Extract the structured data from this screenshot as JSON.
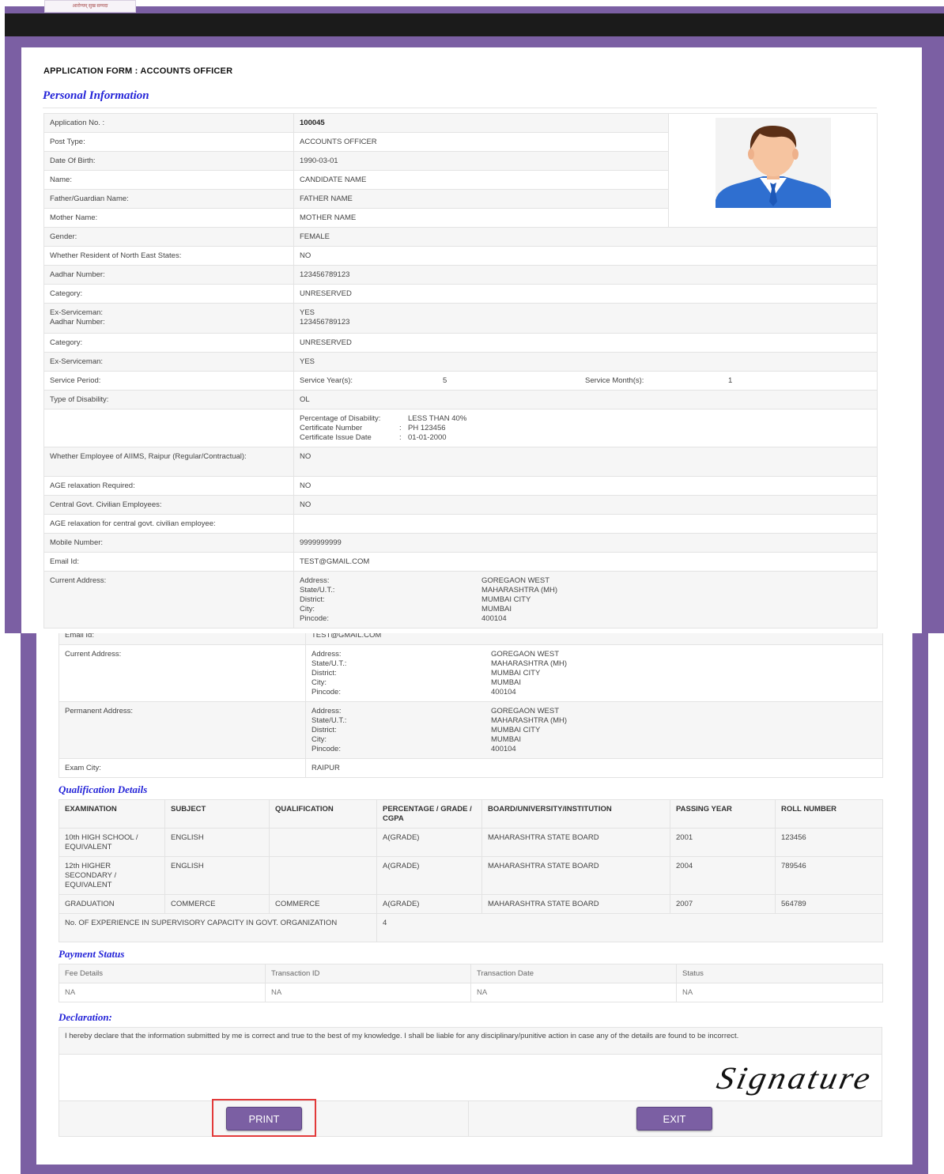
{
  "header": {
    "logo_text": "आरोग्यम् सुख सम्पदा"
  },
  "form": {
    "title": "APPLICATION FORM : ACCOUNTS OFFICER",
    "personal_title": "Personal Information"
  },
  "personal_rows": [
    {
      "label": "Application No. :",
      "value": "100045"
    },
    {
      "label": "Post Type:",
      "value": "ACCOUNTS OFFICER"
    },
    {
      "label": "Date Of Birth:",
      "value": "1990-03-01"
    },
    {
      "label": "Name:",
      "value": "CANDIDATE NAME"
    },
    {
      "label": "Father/Guardian Name:",
      "value": "FATHER NAME"
    },
    {
      "label": "Mother Name:",
      "value": "MOTHER NAME"
    },
    {
      "label": "Gender:",
      "value": "FEMALE"
    },
    {
      "label": "Whether Resident of North East States:",
      "value": "NO"
    },
    {
      "label": "Aadhar Number:",
      "value": "123456789123"
    },
    {
      "label": "Category:",
      "value": "UNRESERVED"
    }
  ],
  "exservice_block": {
    "label1": "Ex-Serviceman:",
    "label2": "Aadhar Number:",
    "value1": "YES",
    "value2": "123456789123"
  },
  "personal_rows2": [
    {
      "label": "Category:",
      "value": "UNRESERVED"
    },
    {
      "label": "Ex-Serviceman:",
      "value": "YES"
    }
  ],
  "service": {
    "label": "Service Period:",
    "year_label": "Service Year(s):",
    "years": "5",
    "month_label": "Service Month(s):",
    "months": "1"
  },
  "disability": {
    "label": "Type of Disability:",
    "value": "OL",
    "pct_label": "Percentage of Disability:",
    "pct": "LESS THAN 40%",
    "cert_label": "Certificate Number",
    "cert": "PH 123456",
    "issue_label": "Certificate Issue Date",
    "issue": "01-01-2000",
    "sep1": ":",
    "sep2": ":"
  },
  "personal_rows3": [
    {
      "label": "Whether Employee of AIIMS, Raipur (Regular/Contractual):",
      "value": "NO"
    },
    {
      "label": "AGE relaxation Required:",
      "value": "NO"
    },
    {
      "label": "Central Govt. Civilian Employees:",
      "value": "NO"
    },
    {
      "label": "AGE relaxation for central govt. civilian employee:",
      "value": ""
    },
    {
      "label": "Mobile Number:",
      "value": "9999999999"
    },
    {
      "label": "Email Id:",
      "value": "TEST@GMAIL.COM"
    }
  ],
  "address_keys": [
    "Address:",
    "State/U.T.:",
    "District:",
    "City:",
    "Pincode:"
  ],
  "current_address": {
    "label": "Current Address:",
    "values": [
      "GOREGAON WEST",
      "MAHARASHTRA (MH)",
      "MUMBAI CITY",
      "MUMBAI",
      "400104"
    ]
  },
  "permanent_address": {
    "label": "Permanent Address:",
    "values": [
      "GOREGAON WEST",
      "MAHARASHTRA (MH)",
      "MUMBAI CITY",
      "MUMBAI",
      "400104"
    ]
  },
  "exam_city": {
    "label": "Exam City:",
    "value": "RAIPUR"
  },
  "cut_email": {
    "label": "Email Id:",
    "value": "TEST@GMAIL.COM"
  },
  "qualification": {
    "title": "Qualification Details",
    "headers": [
      "EXAMINATION",
      "SUBJECT",
      "QUALIFICATION",
      "PERCENTAGE / GRADE / CGPA",
      "BOARD/UNIVERSITY/INSTITUTION",
      "PASSING YEAR",
      "ROLL NUMBER"
    ],
    "rows": [
      [
        "10th HIGH SCHOOL / EQUIVALENT",
        "ENGLISH",
        "",
        "A(GRADE)",
        "MAHARASHTRA STATE BOARD",
        "2001",
        "123456"
      ],
      [
        "12th HIGHER SECONDARY / EQUIVALENT",
        "ENGLISH",
        "",
        "A(GRADE)",
        "MAHARASHTRA STATE BOARD",
        "2004",
        "789546"
      ],
      [
        "GRADUATION",
        "COMMERCE",
        "COMMERCE",
        "A(GRADE)",
        "MAHARASHTRA STATE BOARD",
        "2007",
        "564789"
      ]
    ],
    "experience_label": "No. OF EXPERIENCE IN SUPERVISORY CAPACITY IN GOVT. ORGANIZATION",
    "experience_value": "4"
  },
  "payment": {
    "title": "Payment Status",
    "headers": [
      "Fee Details",
      "Transaction ID",
      "Transaction Date",
      "Status"
    ],
    "row": [
      "NA",
      "NA",
      "NA",
      "NA"
    ]
  },
  "declaration": {
    "title": "Declaration:",
    "text": "I hereby declare that the information submitted by me is correct and true to the best of my knowledge. I shall be liable for any disciplinary/punitive action in case any of the details are found to be incorrect.",
    "signature": "Signature"
  },
  "buttons": {
    "print": "PRINT",
    "exit": "EXIT"
  },
  "colors": {
    "frame": "#7b5fa3",
    "section_title": "#2424d8",
    "highlight": "#e23a3a",
    "topbar": "#1b1b1b"
  }
}
